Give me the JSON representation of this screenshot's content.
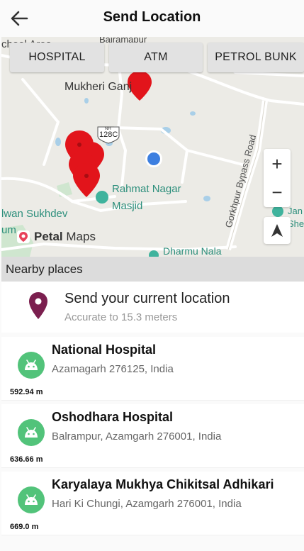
{
  "header": {
    "title": "Send Location"
  },
  "map": {
    "filters": [
      {
        "label": "HOSPITAL"
      },
      {
        "label": "ATM"
      },
      {
        "label": "PETROL BUNK"
      }
    ],
    "labels": {
      "school_area": "chool Area",
      "bairamapur": "Bairamapur",
      "mukheri_ganj": "Mukheri Ganj",
      "nh_shield_top": "NH",
      "nh_shield_num": "128C",
      "rahmat_nagar_line1": "Rahmat Nagar",
      "rahmat_nagar_line2": "Masjid",
      "sukhdev": "lwan Sukhdev",
      "um": "um",
      "gorkhpur_road": "Gorkhpur Bypass Road",
      "jan": "Jan",
      "she": "She",
      "dharmu_nala": "Dharmu Nala"
    },
    "brand": {
      "name": "Petal",
      "suffix": "Maps"
    },
    "zoom_in": "+",
    "zoom_out": "−"
  },
  "nearby": {
    "header": "Nearby places"
  },
  "current_location": {
    "title": "Send your current location",
    "accuracy": "Accurate to 15.3 meters"
  },
  "places": [
    {
      "name": "National Hospital",
      "address": "Azamagarh 276125, India",
      "distance": "592.94 m"
    },
    {
      "name": "Oshodhara Hospital",
      "address": "Balrampur, Azamgarh 276001, India",
      "distance": "636.66 m"
    },
    {
      "name": "Karyalaya Mukhya Chikitsal Adhikari",
      "address": "Hari Ki Chungi, Azamgarh 276001, India",
      "distance": "669.0 m"
    }
  ],
  "colors": {
    "accent_pin": "#7b1f4f",
    "marker_red": "#e2141b",
    "place_icon_green": "#52c37a",
    "my_location_blue": "#3d7fe0"
  }
}
